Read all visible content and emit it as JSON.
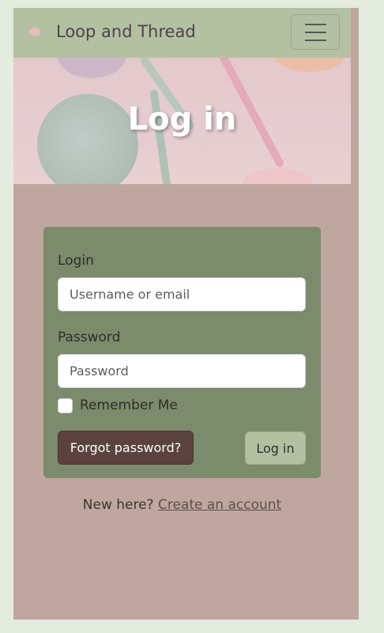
{
  "navbar": {
    "brand": "Loop and Thread",
    "menu_icon": "hamburger-icon"
  },
  "hero": {
    "title": "Log in"
  },
  "form": {
    "login_label": "Login",
    "login_placeholder": "Username or email",
    "password_label": "Password",
    "password_placeholder": "Password",
    "remember_label": "Remember Me",
    "forgot_button": "Forgot password?",
    "login_button": "Log in"
  },
  "footer": {
    "prompt": "New here?",
    "signup_link": "Create an account"
  },
  "colors": {
    "navbar": "#b3c1a2",
    "page_background": "#bfa7a0",
    "card": "#7c8b6b",
    "forgot_button": "#5b423e"
  }
}
